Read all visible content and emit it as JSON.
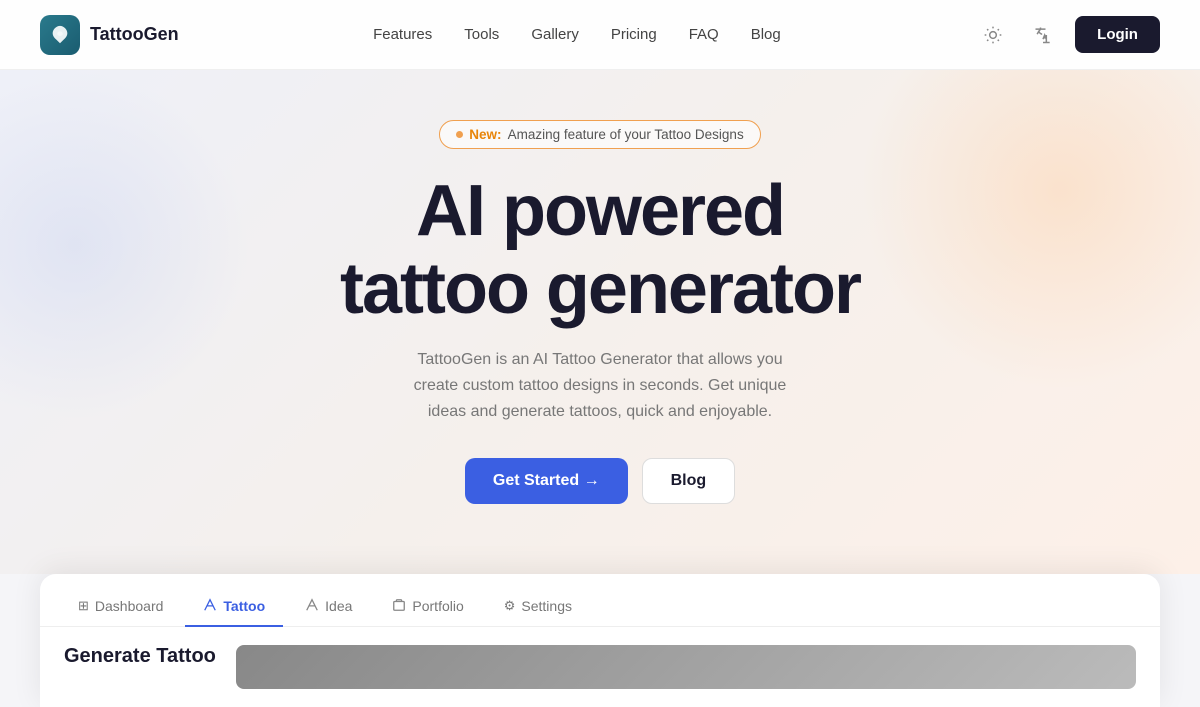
{
  "logo": {
    "icon": "🎨",
    "text": "TattooGen"
  },
  "nav": {
    "links": [
      {
        "label": "Features",
        "href": "#"
      },
      {
        "label": "Tools",
        "href": "#"
      },
      {
        "label": "Gallery",
        "href": "#"
      },
      {
        "label": "Pricing",
        "href": "#"
      },
      {
        "label": "FAQ",
        "href": "#"
      },
      {
        "label": "Blog",
        "href": "#"
      }
    ],
    "login_label": "Login"
  },
  "hero": {
    "badge_dot": "●",
    "badge_new": "New:",
    "badge_text": "Amazing feature of your Tattoo Designs",
    "title_line1": "AI powered",
    "title_line2": "tattoo generator",
    "subtitle": "TattooGen is an AI Tattoo Generator that allows you create custom tattoo designs in seconds. Get unique ideas and generate tattoos, quick and enjoyable.",
    "cta_primary": "Get Started →",
    "cta_secondary": "Blog"
  },
  "app_preview": {
    "tabs": [
      {
        "label": "Dashboard",
        "icon": "⊞",
        "active": false
      },
      {
        "label": "Tattoo",
        "icon": "✦",
        "active": true
      },
      {
        "label": "Idea",
        "icon": "✦",
        "active": false
      },
      {
        "label": "Portfolio",
        "icon": "✦",
        "active": false
      },
      {
        "label": "Settings",
        "icon": "⚙",
        "active": false
      }
    ],
    "section_title": "Generate Tattoo"
  },
  "icons": {
    "sun": "✺",
    "translate": "A"
  }
}
